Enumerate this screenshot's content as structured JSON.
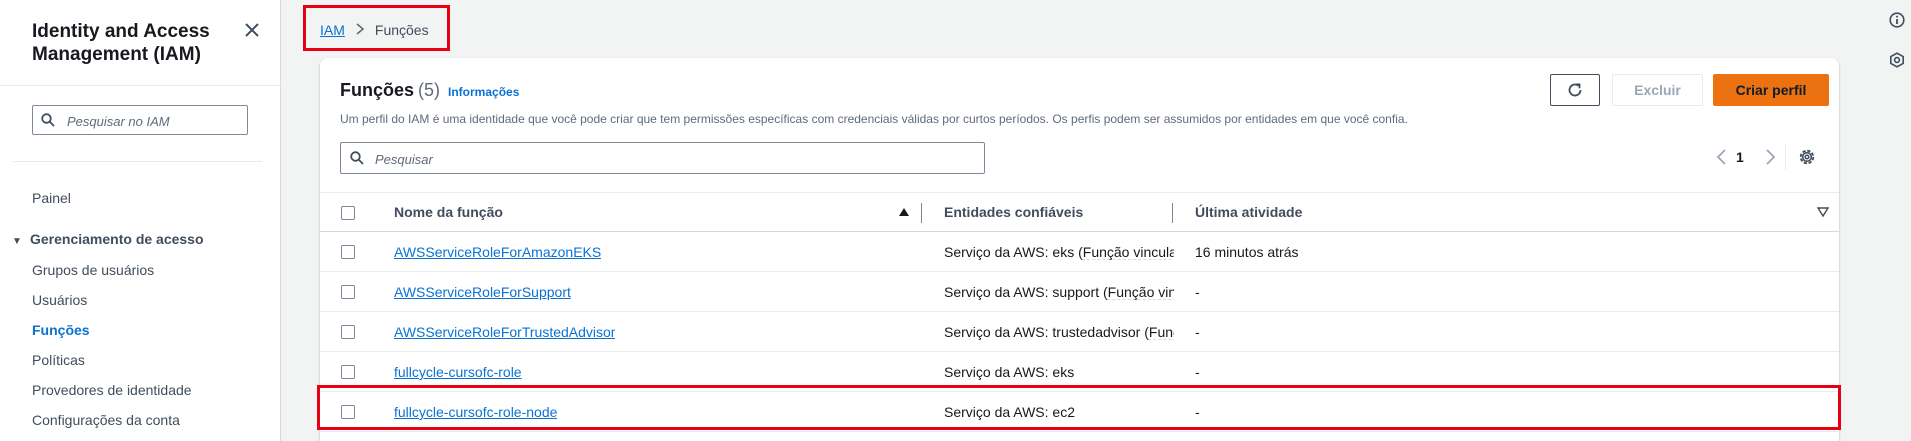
{
  "sidebar": {
    "title": "Identity and Access Management (IAM)",
    "search_placeholder": "Pesquisar no IAM",
    "dashboard": "Painel",
    "section_access": "Gerenciamento de acesso",
    "items": [
      {
        "label": "Grupos de usuários",
        "active": false
      },
      {
        "label": "Usuários",
        "active": false
      },
      {
        "label": "Funções",
        "active": true
      },
      {
        "label": "Políticas",
        "active": false
      },
      {
        "label": "Provedores de identidade",
        "active": false
      },
      {
        "label": "Configurações da conta",
        "active": false
      }
    ]
  },
  "breadcrumb": {
    "root": "IAM",
    "current": "Funções"
  },
  "panel": {
    "title": "Funções",
    "count": "(5)",
    "info_link": "Informações",
    "description": "Um perfil do IAM é uma identidade que você pode criar que tem permissões específicas com credenciais válidas por curtos períodos. Os perfis podem ser assumidos por entidades em que você confia.",
    "delete_label": "Excluir",
    "create_label": "Criar perfil",
    "search_placeholder": "Pesquisar",
    "page_number": "1"
  },
  "table": {
    "columns": [
      "Nome da função",
      "Entidades confiáveis",
      "Última atividade"
    ],
    "rows": [
      {
        "name": "AWSServiceRoleForAmazonEKS",
        "entity": "Serviço da AWS: eks",
        "entity_suffix": "Função vinculada",
        "activity": "16 minutos atrás"
      },
      {
        "name": "AWSServiceRoleForSupport",
        "entity": "Serviço da AWS: support",
        "entity_suffix": "Função vinculada",
        "activity": "-"
      },
      {
        "name": "AWSServiceRoleForTrustedAdvisor",
        "entity": "Serviço da AWS: trustedadvisor",
        "entity_suffix": "Função vinculada",
        "activity": "-"
      },
      {
        "name": "fullcycle-cursofc-role",
        "entity": "Serviço da AWS: eks",
        "entity_suffix": "",
        "activity": "-"
      },
      {
        "name": "fullcycle-cursofc-role-node",
        "entity": "Serviço da AWS: ec2",
        "entity_suffix": "",
        "activity": "-"
      }
    ]
  },
  "colors": {
    "accent": "#0972d3",
    "primary_button": "#ec7211",
    "highlight": "#e60012"
  },
  "icons": [
    "close-icon",
    "search-icon",
    "caret-down-icon",
    "chevron-right-icon",
    "refresh-icon",
    "chevron-left-icon",
    "settings-icon",
    "sort-ascending-icon",
    "column-menu-icon",
    "info-icon",
    "notifications-icon"
  ]
}
